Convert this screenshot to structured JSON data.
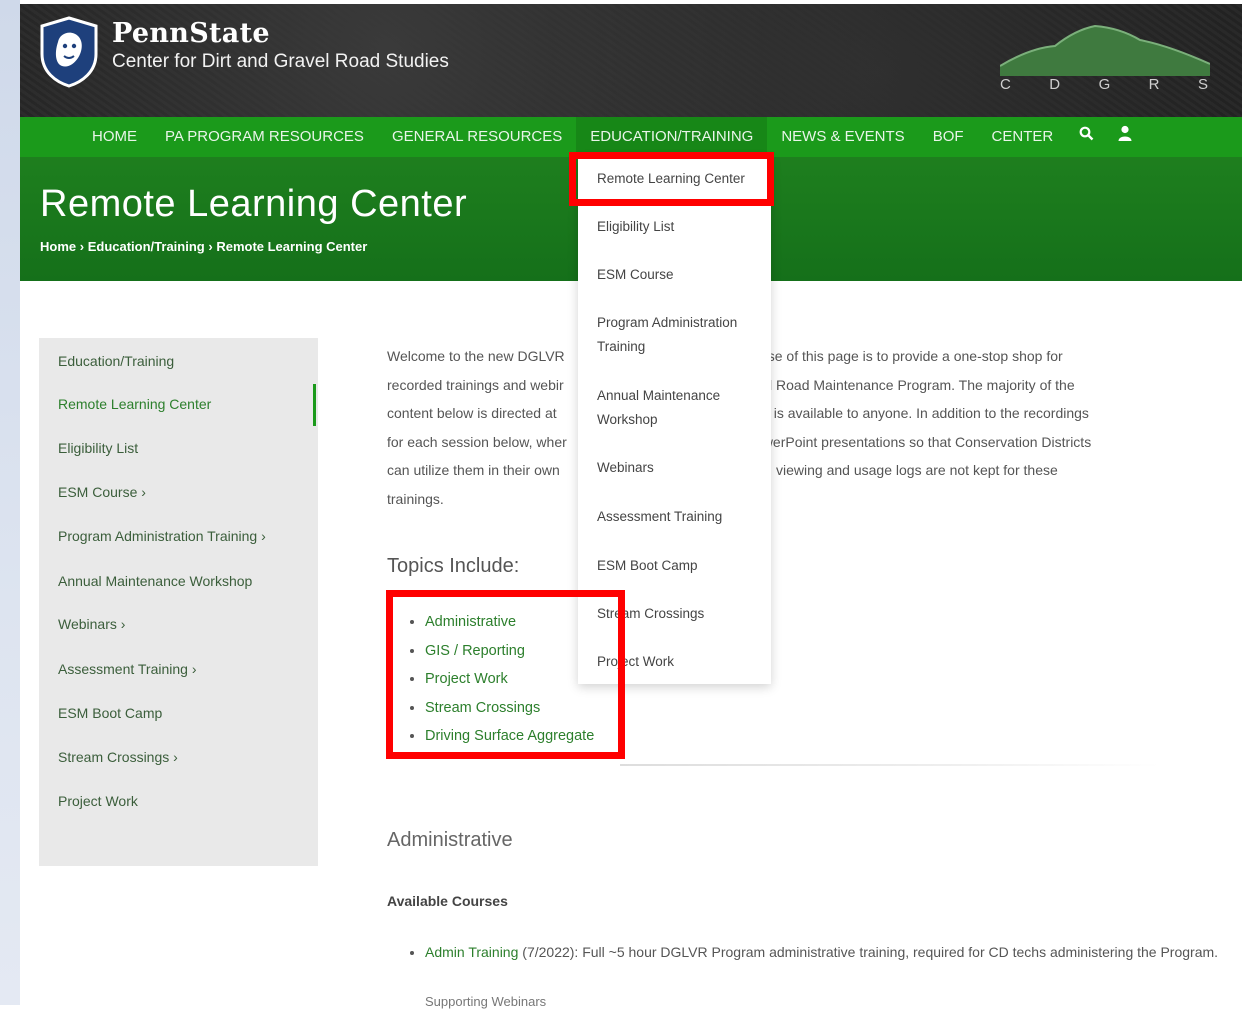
{
  "header": {
    "brand_name": "PennState",
    "brand_subtitle": "Center for Dirt and Gravel Road Studies",
    "cdgrs_letters": [
      "C",
      "D",
      "G",
      "R",
      "S"
    ]
  },
  "nav": {
    "items": [
      {
        "label": "HOME"
      },
      {
        "label": "PA PROGRAM RESOURCES"
      },
      {
        "label": "GENERAL RESOURCES"
      },
      {
        "label": "EDUCATION/TRAINING"
      },
      {
        "label": "NEWS & EVENTS"
      },
      {
        "label": "BOF"
      },
      {
        "label": "CENTER"
      }
    ],
    "search_icon": "search-icon",
    "user_icon": "user-icon"
  },
  "hero": {
    "title": "Remote Learning Center",
    "breadcrumb": [
      "Home",
      "Education/Training",
      "Remote Learning Center"
    ],
    "separator": "›"
  },
  "sidebar": {
    "items": [
      {
        "label": "Education/Training"
      },
      {
        "label": "Remote Learning Center"
      },
      {
        "label": "Eligibility List"
      },
      {
        "label": "ESM Course ›"
      },
      {
        "label": "Program Administration Training ›"
      },
      {
        "label": "Annual Maintenance Workshop"
      },
      {
        "label": "Webinars ›"
      },
      {
        "label": "Assessment Training ›"
      },
      {
        "label": "ESM Boot Camp"
      },
      {
        "label": "Stream Crossings ›"
      },
      {
        "label": "Project Work"
      }
    ]
  },
  "dropdown": {
    "items": [
      {
        "label": "Remote Learning Center"
      },
      {
        "label": "Eligibility List"
      },
      {
        "label": "ESM Course"
      },
      {
        "label": "Program Administration"
      },
      {
        "label": "Training"
      },
      {
        "label": "Annual Maintenance"
      },
      {
        "label": "Workshop"
      },
      {
        "label": "Webinars"
      },
      {
        "label": "Assessment Training"
      },
      {
        "label": "ESM Boot Camp"
      },
      {
        "label": "Stream Crossings"
      },
      {
        "label": "Project Work"
      }
    ]
  },
  "main": {
    "intro_lines": [
      "Welcome to the new DGLVR                                        e propose of this page is to provide a one-stop shop for",
      "recorded trainings and webir                                        d Gravel Road Maintenance Program. The majority of the",
      "content below is directed at                                         though it is available to anyone. In addition to the recordings",
      "for each session below, wher                                        the PowerPoint presentations so that Conservation Districts",
      "can utilize them in their own                                        t for now, viewing and usage logs are not kept for these",
      "trainings."
    ],
    "topics_heading": "Topics Include:",
    "topics": [
      "Administrative",
      "GIS / Reporting",
      "Project Work",
      "Stream Crossings",
      "Driving Surface Aggregate"
    ],
    "admin_heading": "Administrative",
    "available_heading": "Available Courses",
    "course_link": "Admin Training",
    "course_text": " (7/2022): Full ~5 hour DGLVR Program administrative training, required for CD techs administering the Program.",
    "cut_text": "Supporting Webinars"
  },
  "colors": {
    "nav_green": "#1b9a1b",
    "hero_green": "#1e7f1e",
    "link_green": "#2c7f2c",
    "highlight_red": "#ff0000"
  }
}
